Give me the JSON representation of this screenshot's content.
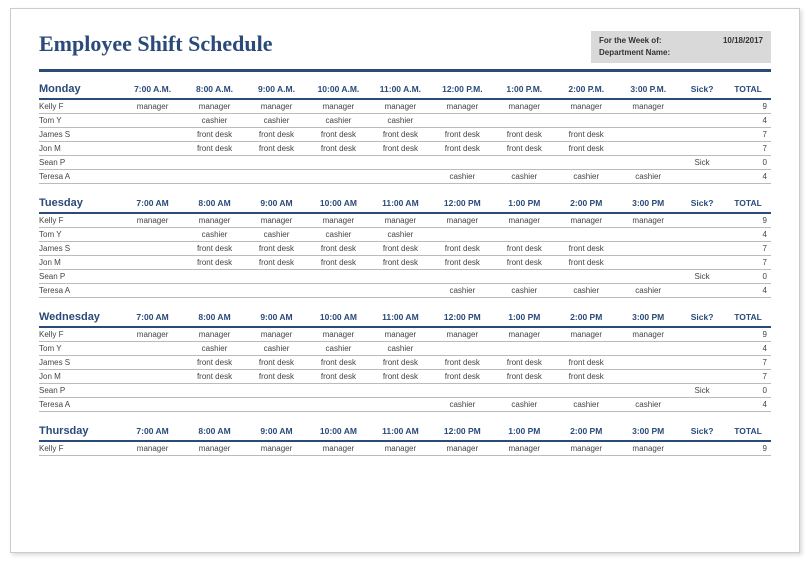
{
  "title": "Employee Shift Schedule",
  "meta": {
    "week_label": "For the Week of:",
    "week_value": "10/18/2017",
    "dept_label": "Department Name:",
    "dept_value": ""
  },
  "columns_fixed": {
    "sick": "Sick?",
    "total": "TOTAL"
  },
  "days": [
    {
      "name": "Monday",
      "times": [
        "7:00 A.M.",
        "8:00 A.M.",
        "9:00 A.M.",
        "10:00 A.M.",
        "11:00 A.M.",
        "12:00 P.M.",
        "1:00 P.M.",
        "2:00 P.M.",
        "3:00 P.M."
      ],
      "rows": [
        {
          "name": "Kelly F",
          "cells": [
            "manager",
            "manager",
            "manager",
            "manager",
            "manager",
            "manager",
            "manager",
            "manager",
            "manager"
          ],
          "sick": "",
          "total": "9"
        },
        {
          "name": "Tom Y",
          "cells": [
            "",
            "cashier",
            "cashier",
            "cashier",
            "cashier",
            "",
            "",
            "",
            ""
          ],
          "sick": "",
          "total": "4"
        },
        {
          "name": "James S",
          "cells": [
            "",
            "front desk",
            "front desk",
            "front desk",
            "front desk",
            "front desk",
            "front desk",
            "front desk",
            ""
          ],
          "sick": "",
          "total": "7"
        },
        {
          "name": "Jon M",
          "cells": [
            "",
            "front desk",
            "front desk",
            "front desk",
            "front desk",
            "front desk",
            "front desk",
            "front desk",
            ""
          ],
          "sick": "",
          "total": "7"
        },
        {
          "name": "Sean P",
          "cells": [
            "",
            "",
            "",
            "",
            "",
            "",
            "",
            "",
            ""
          ],
          "sick": "Sick",
          "total": "0"
        },
        {
          "name": "Teresa A",
          "cells": [
            "",
            "",
            "",
            "",
            "",
            "cashier",
            "cashier",
            "cashier",
            "cashier"
          ],
          "sick": "",
          "total": "4"
        }
      ]
    },
    {
      "name": "Tuesday",
      "times": [
        "7:00 AM",
        "8:00 AM",
        "9:00 AM",
        "10:00 AM",
        "11:00 AM",
        "12:00 PM",
        "1:00 PM",
        "2:00 PM",
        "3:00 PM"
      ],
      "rows": [
        {
          "name": "Kelly F",
          "cells": [
            "manager",
            "manager",
            "manager",
            "manager",
            "manager",
            "manager",
            "manager",
            "manager",
            "manager"
          ],
          "sick": "",
          "total": "9"
        },
        {
          "name": "Tom Y",
          "cells": [
            "",
            "cashier",
            "cashier",
            "cashier",
            "cashier",
            "",
            "",
            "",
            ""
          ],
          "sick": "",
          "total": "4"
        },
        {
          "name": "James S",
          "cells": [
            "",
            "front desk",
            "front desk",
            "front desk",
            "front desk",
            "front desk",
            "front desk",
            "front desk",
            ""
          ],
          "sick": "",
          "total": "7"
        },
        {
          "name": "Jon M",
          "cells": [
            "",
            "front desk",
            "front desk",
            "front desk",
            "front desk",
            "front desk",
            "front desk",
            "front desk",
            ""
          ],
          "sick": "",
          "total": "7"
        },
        {
          "name": "Sean P",
          "cells": [
            "",
            "",
            "",
            "",
            "",
            "",
            "",
            "",
            ""
          ],
          "sick": "Sick",
          "total": "0"
        },
        {
          "name": "Teresa A",
          "cells": [
            "",
            "",
            "",
            "",
            "",
            "cashier",
            "cashier",
            "cashier",
            "cashier"
          ],
          "sick": "",
          "total": "4"
        }
      ]
    },
    {
      "name": "Wednesday",
      "times": [
        "7:00 AM",
        "8:00 AM",
        "9:00 AM",
        "10:00 AM",
        "11:00 AM",
        "12:00 PM",
        "1:00 PM",
        "2:00 PM",
        "3:00 PM"
      ],
      "rows": [
        {
          "name": "Kelly F",
          "cells": [
            "manager",
            "manager",
            "manager",
            "manager",
            "manager",
            "manager",
            "manager",
            "manager",
            "manager"
          ],
          "sick": "",
          "total": "9"
        },
        {
          "name": "Tom Y",
          "cells": [
            "",
            "cashier",
            "cashier",
            "cashier",
            "cashier",
            "",
            "",
            "",
            ""
          ],
          "sick": "",
          "total": "4"
        },
        {
          "name": "James S",
          "cells": [
            "",
            "front desk",
            "front desk",
            "front desk",
            "front desk",
            "front desk",
            "front desk",
            "front desk",
            ""
          ],
          "sick": "",
          "total": "7"
        },
        {
          "name": "Jon M",
          "cells": [
            "",
            "front desk",
            "front desk",
            "front desk",
            "front desk",
            "front desk",
            "front desk",
            "front desk",
            ""
          ],
          "sick": "",
          "total": "7"
        },
        {
          "name": "Sean P",
          "cells": [
            "",
            "",
            "",
            "",
            "",
            "",
            "",
            "",
            ""
          ],
          "sick": "Sick",
          "total": "0"
        },
        {
          "name": "Teresa A",
          "cells": [
            "",
            "",
            "",
            "",
            "",
            "cashier",
            "cashier",
            "cashier",
            "cashier"
          ],
          "sick": "",
          "total": "4"
        }
      ]
    },
    {
      "name": "Thursday",
      "times": [
        "7:00 AM",
        "8:00 AM",
        "9:00 AM",
        "10:00 AM",
        "11:00 AM",
        "12:00 PM",
        "1:00 PM",
        "2:00 PM",
        "3:00 PM"
      ],
      "rows": [
        {
          "name": "Kelly F",
          "cells": [
            "manager",
            "manager",
            "manager",
            "manager",
            "manager",
            "manager",
            "manager",
            "manager",
            "manager"
          ],
          "sick": "",
          "total": "9"
        }
      ]
    }
  ]
}
